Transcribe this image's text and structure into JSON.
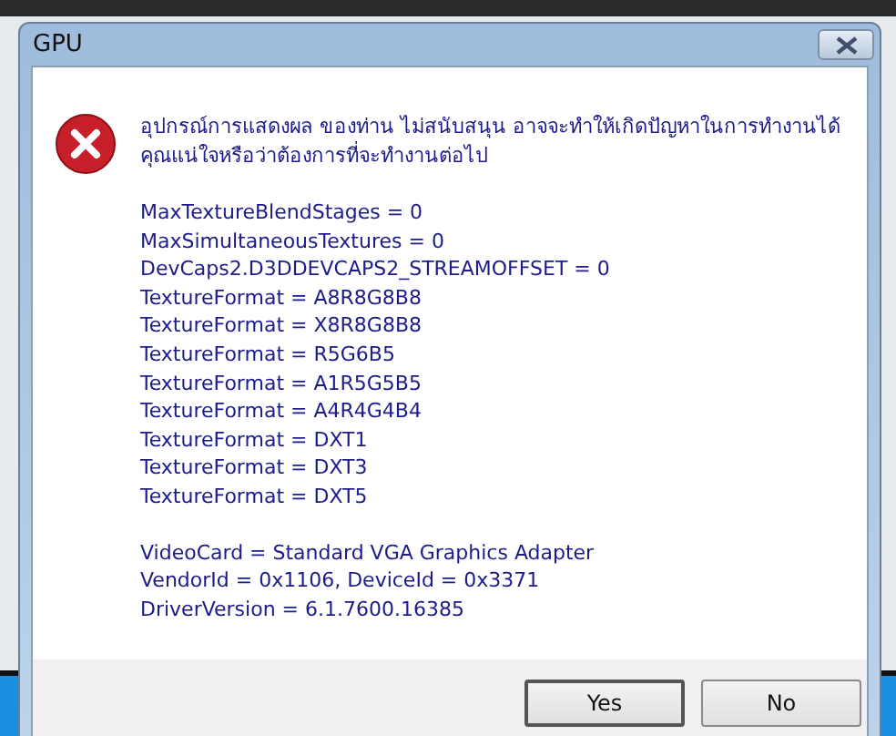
{
  "window": {
    "title": "GPU"
  },
  "message": "อุปกรณ์การแสดงผล ของท่าน ไม่สนับสนุน อาจจะทำให้เกิดปัญหาในการทำงานได้ คุณแน่ใจหรือว่าต้องการที่จะทำงานต่อไป",
  "details": [
    [
      "MaxTextureBlendStages = 0",
      "MaxSimultaneousTextures = 0",
      "DevCaps2.D3DDEVCAPS2_STREAMOFFSET = 0",
      "TextureFormat = A8R8G8B8",
      "TextureFormat = X8R8G8B8",
      "TextureFormat = R5G6B5",
      "TextureFormat = A1R5G5B5",
      "TextureFormat = A4R4G4B4",
      "TextureFormat = DXT1",
      "TextureFormat = DXT3",
      "TextureFormat = DXT5"
    ],
    [
      "VideoCard = Standard VGA Graphics Adapter",
      "VendorId = 0x1106, DeviceId = 0x3371",
      "DriverVersion = 6.1.7600.16385"
    ]
  ],
  "buttons": [
    "Yes",
    "No"
  ]
}
